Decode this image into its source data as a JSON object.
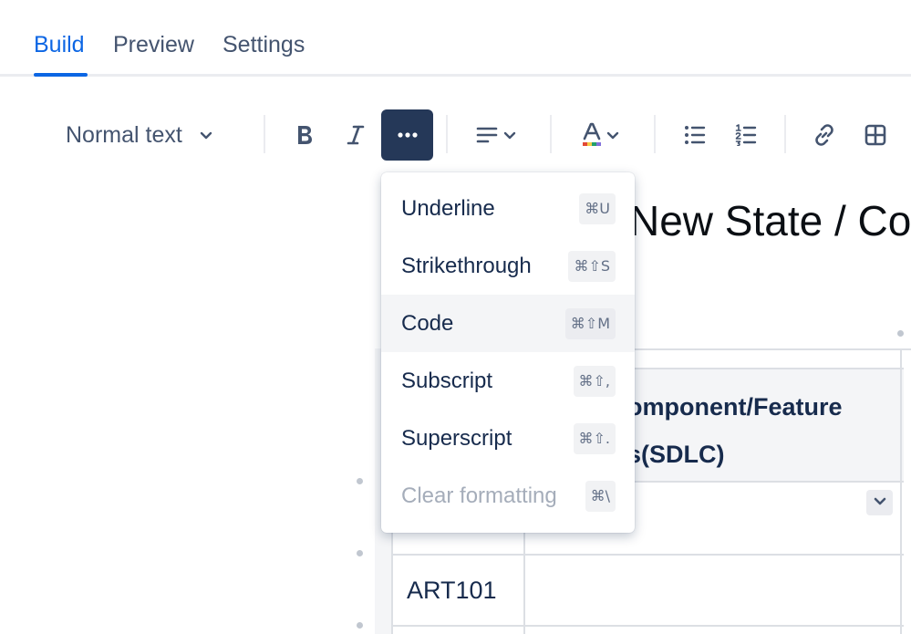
{
  "tabs": [
    {
      "label": "Build"
    },
    {
      "label": "Preview"
    },
    {
      "label": "Settings"
    }
  ],
  "active_tab": "Build",
  "toolbar": {
    "text_style": "Normal text",
    "buttons": [
      "bold-icon",
      "italic-icon",
      "more-formatting-icon",
      "align-icon",
      "text-color-icon",
      "bullet-list-icon",
      "numbered-list-icon",
      "link-icon",
      "table-icon"
    ]
  },
  "menu": {
    "items": [
      {
        "label": "Underline",
        "shortcut": "⌘U"
      },
      {
        "label": "Strikethrough",
        "shortcut": "⌘⇧S"
      },
      {
        "label": "Code",
        "shortcut": "⌘⇧M"
      },
      {
        "label": "Subscript",
        "shortcut": "⌘⇧,"
      },
      {
        "label": "Superscript",
        "shortcut": "⌘⇧."
      },
      {
        "label": "Clear formatting",
        "shortcut": "⌘\\"
      }
    ]
  },
  "document": {
    "title": "New State / Co",
    "table": {
      "header_cell": "omponent/Feature\ns(SDLC)",
      "rows": [
        {
          "cell": "ART101"
        }
      ]
    }
  },
  "colors": {
    "accent": "#0C66E4",
    "active_button": "#253858",
    "text": "#172B4D",
    "muted": "#44546F"
  }
}
